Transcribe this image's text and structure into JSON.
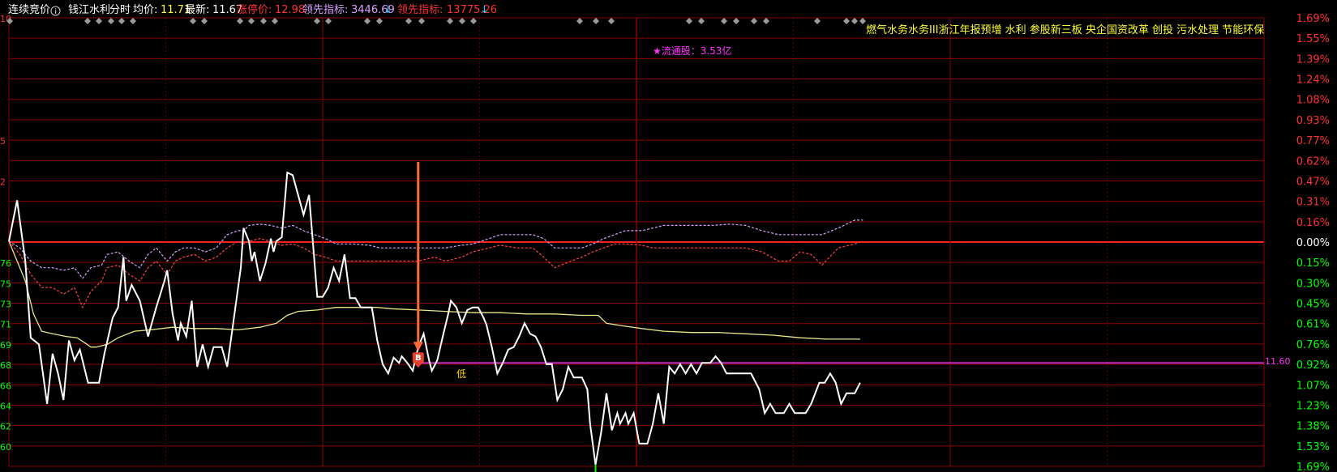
{
  "header": {
    "auction_label": "连续竞价",
    "info_icon": "info-icon",
    "stock_name": "钱江水利",
    "mode": "分时",
    "avg_label": "均价:",
    "avg_value": "11.71",
    "last_label": "最新:",
    "last_value": "11.67",
    "limit_up_label": "涨停价:",
    "limit_up_value": "12.98",
    "lead1_label": "领先指标:",
    "lead1_value": "3446.69",
    "lead1_arrow": "↓",
    "lead2_label": "领先指标:",
    "lead2_value": "13775.26",
    "lead2_arrow": "↓"
  },
  "concepts": "燃气水务水务III浙江年报预增 水利 参股新三板 央企国资改革 创投 污水处理 节能环保",
  "float_note": "★流通股：3.53亿",
  "low_note": "低",
  "avg_price_line_label": "11.60",
  "signal_badge": "B",
  "colors": {
    "background": "#000000",
    "grid": "#8b0000",
    "zero_line": "#ff2020",
    "price_line": "#ffffff",
    "avg_line": "#e8e88a",
    "purple_dash": "#d8a0ff",
    "red_dash": "#ff4040",
    "magenta_line": "#ff33ff",
    "up_text": "#ff3030",
    "down_text": "#00ff00",
    "arrow": "#ff6a3d",
    "diamond": "#9a9a9a"
  },
  "chart_data": {
    "type": "line",
    "title": "",
    "xlabel": "",
    "ylabel": "",
    "ylim": [
      -1.69,
      1.69
    ],
    "right_axis_ticks": [
      "1.69%",
      "1.55%",
      "1.39%",
      "1.24%",
      "1.08%",
      "0.93%",
      "0.77%",
      "0.62%",
      "0.47%",
      "0.31%",
      "0.16%",
      "0.00%",
      "0.15%",
      "0.30%",
      "0.45%",
      "0.61%",
      "0.76%",
      "0.92%",
      "1.07%",
      "1.23%",
      "1.38%",
      "1.53%",
      "1.69%"
    ],
    "left_axis_ticks": [
      "10",
      "",
      "",
      "",
      "",
      "",
      "5",
      "",
      "2",
      "",
      "",
      "",
      "76",
      "75",
      "73",
      "71",
      "69",
      "68",
      "66",
      "64",
      "62",
      "60",
      ""
    ],
    "price_series": [
      [
        0,
        0.0
      ],
      [
        3,
        0.31
      ],
      [
        6,
        -0.15
      ],
      [
        8,
        -0.73
      ],
      [
        11,
        -0.78
      ],
      [
        14,
        -1.23
      ],
      [
        16,
        -0.85
      ],
      [
        18,
        -1.0
      ],
      [
        20,
        -1.2
      ],
      [
        22,
        -0.75
      ],
      [
        24,
        -0.9
      ],
      [
        26,
        -0.82
      ],
      [
        29,
        -1.07
      ],
      [
        33,
        -1.07
      ],
      [
        35,
        -0.85
      ],
      [
        38,
        -0.58
      ],
      [
        40,
        -0.5
      ],
      [
        42,
        -0.12
      ],
      [
        43,
        -0.45
      ],
      [
        45,
        -0.33
      ],
      [
        48,
        -0.45
      ],
      [
        51,
        -0.72
      ],
      [
        54,
        -0.5
      ],
      [
        57,
        -0.3
      ],
      [
        58,
        -0.22
      ],
      [
        60,
        -0.55
      ],
      [
        62,
        -0.75
      ],
      [
        63,
        -0.62
      ],
      [
        65,
        -0.72
      ],
      [
        67,
        -0.45
      ],
      [
        69,
        -0.95
      ],
      [
        71,
        -0.78
      ],
      [
        73,
        -0.95
      ],
      [
        75,
        -0.8
      ],
      [
        78,
        -0.8
      ],
      [
        80,
        -0.95
      ],
      [
        83,
        -0.5
      ],
      [
        85,
        -0.2
      ],
      [
        86,
        0.1
      ],
      [
        88,
        0.0
      ],
      [
        89,
        -0.15
      ],
      [
        90,
        -0.08
      ],
      [
        92,
        -0.3
      ],
      [
        94,
        -0.17
      ],
      [
        96,
        0.02
      ],
      [
        97,
        -0.08
      ],
      [
        98,
        0.0
      ],
      [
        100,
        0.03
      ],
      [
        102,
        0.52
      ],
      [
        104,
        0.5
      ],
      [
        106,
        0.35
      ],
      [
        108,
        0.2
      ],
      [
        110,
        0.35
      ],
      [
        111,
        0.1
      ],
      [
        113,
        -0.42
      ],
      [
        115,
        -0.42
      ],
      [
        117,
        -0.35
      ],
      [
        119,
        -0.2
      ],
      [
        121,
        -0.3
      ],
      [
        123,
        -0.1
      ],
      [
        125,
        -0.43
      ],
      [
        127,
        -0.43
      ],
      [
        129,
        -0.5
      ],
      [
        133,
        -0.5
      ],
      [
        135,
        -0.75
      ],
      [
        137,
        -0.93
      ],
      [
        139,
        -1.0
      ],
      [
        141,
        -0.88
      ],
      [
        143,
        -0.92
      ],
      [
        144,
        -0.87
      ],
      [
        146,
        -0.92
      ],
      [
        148,
        -0.98
      ],
      [
        150,
        -0.8
      ],
      [
        152,
        -0.7
      ],
      [
        154,
        -0.9
      ],
      [
        155,
        -0.98
      ],
      [
        157,
        -0.9
      ],
      [
        159,
        -0.72
      ],
      [
        161,
        -0.55
      ],
      [
        162,
        -0.45
      ],
      [
        164,
        -0.5
      ],
      [
        166,
        -0.62
      ],
      [
        168,
        -0.52
      ],
      [
        170,
        -0.5
      ],
      [
        172,
        -0.5
      ],
      [
        174,
        -0.58
      ],
      [
        175,
        -0.63
      ],
      [
        177,
        -0.8
      ],
      [
        179,
        -1.0
      ],
      [
        181,
        -0.92
      ],
      [
        183,
        -0.82
      ],
      [
        185,
        -0.8
      ],
      [
        187,
        -0.72
      ],
      [
        189,
        -0.62
      ],
      [
        191,
        -0.7
      ],
      [
        193,
        -0.72
      ],
      [
        195,
        -0.8
      ],
      [
        197,
        -0.93
      ],
      [
        199,
        -0.93
      ],
      [
        201,
        -1.2
      ],
      [
        203,
        -1.12
      ],
      [
        205,
        -0.95
      ],
      [
        207,
        -1.03
      ],
      [
        210,
        -1.03
      ],
      [
        212,
        -1.12
      ],
      [
        213,
        -1.38
      ],
      [
        215,
        -1.69
      ],
      [
        217,
        -1.45
      ],
      [
        219,
        -1.15
      ],
      [
        221,
        -1.43
      ],
      [
        223,
        -1.3
      ],
      [
        224,
        -1.38
      ],
      [
        226,
        -1.3
      ],
      [
        227,
        -1.38
      ],
      [
        229,
        -1.3
      ],
      [
        231,
        -1.53
      ],
      [
        234,
        -1.53
      ],
      [
        236,
        -1.38
      ],
      [
        238,
        -1.15
      ],
      [
        240,
        -1.38
      ],
      [
        242,
        -0.95
      ],
      [
        244,
        -1.0
      ],
      [
        246,
        -0.93
      ],
      [
        248,
        -1.0
      ],
      [
        250,
        -0.93
      ],
      [
        252,
        -1.0
      ],
      [
        254,
        -0.92
      ],
      [
        257,
        -0.92
      ],
      [
        259,
        -0.87
      ],
      [
        261,
        -0.92
      ],
      [
        263,
        -1.0
      ],
      [
        267,
        -1.0
      ],
      [
        269,
        -1.0
      ],
      [
        272,
        -1.0
      ],
      [
        275,
        -1.12
      ],
      [
        277,
        -1.3
      ],
      [
        279,
        -1.23
      ],
      [
        281,
        -1.3
      ],
      [
        284,
        -1.3
      ],
      [
        286,
        -1.23
      ],
      [
        288,
        -1.3
      ],
      [
        292,
        -1.3
      ],
      [
        294,
        -1.23
      ],
      [
        297,
        -1.07
      ],
      [
        299,
        -1.07
      ],
      [
        301,
        -1.0
      ],
      [
        303,
        -1.07
      ],
      [
        305,
        -1.23
      ],
      [
        307,
        -1.15
      ],
      [
        310,
        -1.15
      ],
      [
        312,
        -1.07
      ]
    ],
    "avg_series": [
      [
        0,
        0.0
      ],
      [
        3,
        -0.15
      ],
      [
        6,
        -0.3
      ],
      [
        9,
        -0.55
      ],
      [
        12,
        -0.68
      ],
      [
        16,
        -0.7
      ],
      [
        21,
        -0.72
      ],
      [
        25,
        -0.73
      ],
      [
        28,
        -0.77
      ],
      [
        30,
        -0.8
      ],
      [
        32,
        -0.8
      ],
      [
        36,
        -0.78
      ],
      [
        40,
        -0.73
      ],
      [
        46,
        -0.68
      ],
      [
        52,
        -0.67
      ],
      [
        60,
        -0.65
      ],
      [
        68,
        -0.66
      ],
      [
        76,
        -0.66
      ],
      [
        84,
        -0.67
      ],
      [
        92,
        -0.65
      ],
      [
        98,
        -0.62
      ],
      [
        102,
        -0.56
      ],
      [
        106,
        -0.53
      ],
      [
        113,
        -0.52
      ],
      [
        120,
        -0.5
      ],
      [
        128,
        -0.5
      ],
      [
        135,
        -0.5
      ],
      [
        140,
        -0.51
      ],
      [
        150,
        -0.52
      ],
      [
        160,
        -0.53
      ],
      [
        170,
        -0.54
      ],
      [
        180,
        -0.54
      ],
      [
        190,
        -0.55
      ],
      [
        200,
        -0.55
      ],
      [
        210,
        -0.56
      ],
      [
        216,
        -0.56
      ],
      [
        219,
        -0.62
      ],
      [
        225,
        -0.64
      ],
      [
        232,
        -0.66
      ],
      [
        240,
        -0.68
      ],
      [
        250,
        -0.69
      ],
      [
        260,
        -0.69
      ],
      [
        270,
        -0.7
      ],
      [
        280,
        -0.71
      ],
      [
        290,
        -0.73
      ],
      [
        300,
        -0.74
      ],
      [
        312,
        -0.74
      ]
    ],
    "purple_series": [
      [
        0,
        0.0
      ],
      [
        4,
        -0.05
      ],
      [
        8,
        -0.15
      ],
      [
        12,
        -0.2
      ],
      [
        16,
        -0.2
      ],
      [
        20,
        -0.22
      ],
      [
        24,
        -0.2
      ],
      [
        27,
        -0.28
      ],
      [
        30,
        -0.2
      ],
      [
        34,
        -0.18
      ],
      [
        36,
        -0.1
      ],
      [
        40,
        -0.08
      ],
      [
        44,
        -0.15
      ],
      [
        48,
        -0.2
      ],
      [
        51,
        -0.1
      ],
      [
        54,
        -0.05
      ],
      [
        58,
        -0.15
      ],
      [
        61,
        -0.08
      ],
      [
        64,
        -0.05
      ],
      [
        68,
        -0.05
      ],
      [
        72,
        -0.08
      ],
      [
        76,
        -0.05
      ],
      [
        80,
        0.05
      ],
      [
        84,
        0.08
      ],
      [
        86,
        0.08
      ],
      [
        88,
        0.12
      ],
      [
        92,
        0.13
      ],
      [
        96,
        0.12
      ],
      [
        100,
        0.1
      ],
      [
        104,
        0.12
      ],
      [
        108,
        0.08
      ],
      [
        112,
        0.05
      ],
      [
        116,
        0.02
      ],
      [
        120,
        -0.02
      ],
      [
        126,
        -0.02
      ],
      [
        132,
        -0.03
      ],
      [
        136,
        -0.05
      ],
      [
        140,
        -0.05
      ],
      [
        146,
        -0.05
      ],
      [
        150,
        -0.05
      ],
      [
        156,
        -0.05
      ],
      [
        160,
        -0.05
      ],
      [
        166,
        -0.03
      ],
      [
        170,
        -0.02
      ],
      [
        176,
        0.02
      ],
      [
        180,
        0.05
      ],
      [
        186,
        0.05
      ],
      [
        192,
        0.05
      ],
      [
        196,
        0.02
      ],
      [
        200,
        -0.05
      ],
      [
        206,
        -0.05
      ],
      [
        210,
        -0.05
      ],
      [
        214,
        -0.02
      ],
      [
        218,
        0.02
      ],
      [
        222,
        0.05
      ],
      [
        226,
        0.08
      ],
      [
        232,
        0.08
      ],
      [
        236,
        0.1
      ],
      [
        240,
        0.12
      ],
      [
        246,
        0.12
      ],
      [
        252,
        0.12
      ],
      [
        258,
        0.12
      ],
      [
        264,
        0.13
      ],
      [
        270,
        0.12
      ],
      [
        276,
        0.08
      ],
      [
        282,
        0.05
      ],
      [
        286,
        0.05
      ],
      [
        290,
        0.05
      ],
      [
        294,
        0.05
      ],
      [
        298,
        0.05
      ],
      [
        304,
        0.1
      ],
      [
        310,
        0.16
      ],
      [
        313,
        0.16
      ]
    ],
    "red_series": [
      [
        0,
        0.0
      ],
      [
        4,
        -0.1
      ],
      [
        8,
        -0.25
      ],
      [
        12,
        -0.35
      ],
      [
        16,
        -0.35
      ],
      [
        20,
        -0.4
      ],
      [
        24,
        -0.35
      ],
      [
        27,
        -0.5
      ],
      [
        30,
        -0.38
      ],
      [
        34,
        -0.3
      ],
      [
        36,
        -0.2
      ],
      [
        40,
        -0.18
      ],
      [
        44,
        -0.25
      ],
      [
        48,
        -0.3
      ],
      [
        51,
        -0.2
      ],
      [
        54,
        -0.15
      ],
      [
        58,
        -0.25
      ],
      [
        61,
        -0.15
      ],
      [
        64,
        -0.12
      ],
      [
        68,
        -0.1
      ],
      [
        72,
        -0.15
      ],
      [
        76,
        -0.12
      ],
      [
        80,
        -0.05
      ],
      [
        84,
        0.0
      ],
      [
        86,
        -0.02
      ],
      [
        88,
        0.0
      ],
      [
        92,
        0.02
      ],
      [
        96,
        0.0
      ],
      [
        100,
        -0.03
      ],
      [
        104,
        -0.02
      ],
      [
        108,
        -0.05
      ],
      [
        112,
        -0.1
      ],
      [
        116,
        -0.12
      ],
      [
        120,
        -0.15
      ],
      [
        126,
        -0.15
      ],
      [
        132,
        -0.15
      ],
      [
        136,
        -0.15
      ],
      [
        140,
        -0.15
      ],
      [
        146,
        -0.15
      ],
      [
        150,
        -0.15
      ],
      [
        156,
        -0.12
      ],
      [
        160,
        -0.15
      ],
      [
        166,
        -0.12
      ],
      [
        170,
        -0.08
      ],
      [
        176,
        -0.05
      ],
      [
        180,
        -0.03
      ],
      [
        186,
        -0.05
      ],
      [
        192,
        -0.05
      ],
      [
        196,
        -0.12
      ],
      [
        200,
        -0.2
      ],
      [
        206,
        -0.15
      ],
      [
        210,
        -0.12
      ],
      [
        214,
        -0.08
      ],
      [
        218,
        -0.05
      ],
      [
        222,
        -0.02
      ],
      [
        226,
        -0.02
      ],
      [
        232,
        -0.03
      ],
      [
        236,
        -0.05
      ],
      [
        240,
        -0.05
      ],
      [
        246,
        -0.05
      ],
      [
        252,
        -0.05
      ],
      [
        258,
        -0.05
      ],
      [
        264,
        -0.05
      ],
      [
        270,
        -0.05
      ],
      [
        276,
        -0.08
      ],
      [
        282,
        -0.15
      ],
      [
        286,
        -0.15
      ],
      [
        290,
        -0.08
      ],
      [
        294,
        -0.1
      ],
      [
        298,
        -0.18
      ],
      [
        304,
        -0.05
      ],
      [
        310,
        -0.02
      ],
      [
        313,
        0.0
      ]
    ],
    "horizontal_line_value": -0.92,
    "signal_point": [
      150,
      -0.92
    ],
    "x_range": [
      0,
      460
    ]
  }
}
